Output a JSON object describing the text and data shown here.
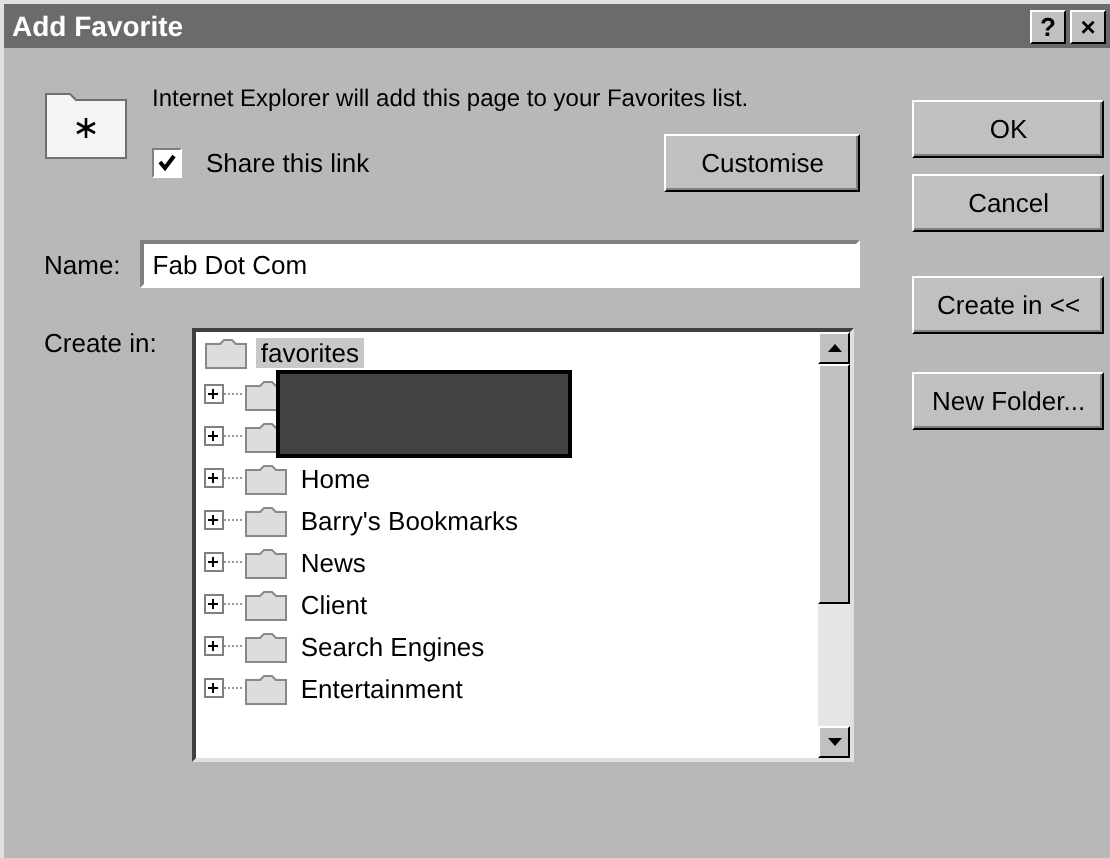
{
  "window": {
    "title": "Add Favorite",
    "title_buttons": [
      "?",
      "×"
    ]
  },
  "message": "Internet Explorer will add this page to your Favorites list.",
  "share": {
    "label": "Share this link",
    "checked": true
  },
  "buttons": {
    "ok": "OK",
    "cancel": "Cancel",
    "customise": "Customise",
    "create_in": "Create in <<",
    "new_folder": "New Folder..."
  },
  "name_field": {
    "label": "Name:",
    "value": "Fab Dot Com"
  },
  "create_in": {
    "label": "Create in:",
    "root": {
      "label": "favorites",
      "selected": true
    },
    "items": [
      {
        "kind": "redacted"
      },
      {
        "kind": "redacted"
      },
      {
        "kind": "folder",
        "label": "Home"
      },
      {
        "kind": "folder",
        "label": "Barry's Bookmarks"
      },
      {
        "kind": "folder",
        "label": "News"
      },
      {
        "kind": "folder",
        "label": "Client"
      },
      {
        "kind": "folder",
        "label": "Search Engines"
      },
      {
        "kind": "folder",
        "label": "Entertainment"
      }
    ]
  }
}
